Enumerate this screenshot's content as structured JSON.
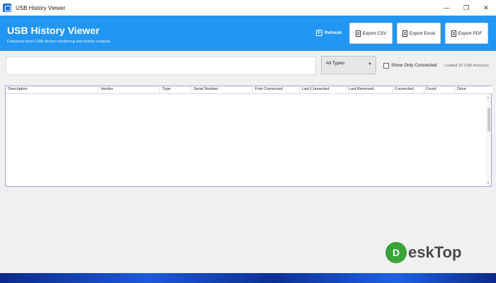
{
  "window": {
    "title": "USB History Viewer",
    "minimize": "—",
    "restore": "❐",
    "close": "✕"
  },
  "header": {
    "title": "USB History Viewer",
    "subtitle": "Enterprise-level USB device monitoring and history analysis",
    "refresh_label": "Refresh",
    "export_csv_label": "Export CSV",
    "export_excel_label": "Export Excel",
    "export_pdf_label": "Export PDF",
    "accent": "#2196f3"
  },
  "filters": {
    "search_value": "",
    "type_selected": "All Types",
    "show_only_connected_label": "Show Only Connected",
    "show_only_connected_checked": false,
    "status": "Loaded 32 USB device(s)"
  },
  "table": {
    "columns": [
      "Description",
      "Vendor",
      "Type",
      "Serial Number",
      "First Connected",
      "Last Connected",
      "Last Removed",
      "Connected",
      "Count",
      "Drive"
    ],
    "rows": []
  },
  "watermark": {
    "logo_letter": "D",
    "text": "eskTop"
  }
}
